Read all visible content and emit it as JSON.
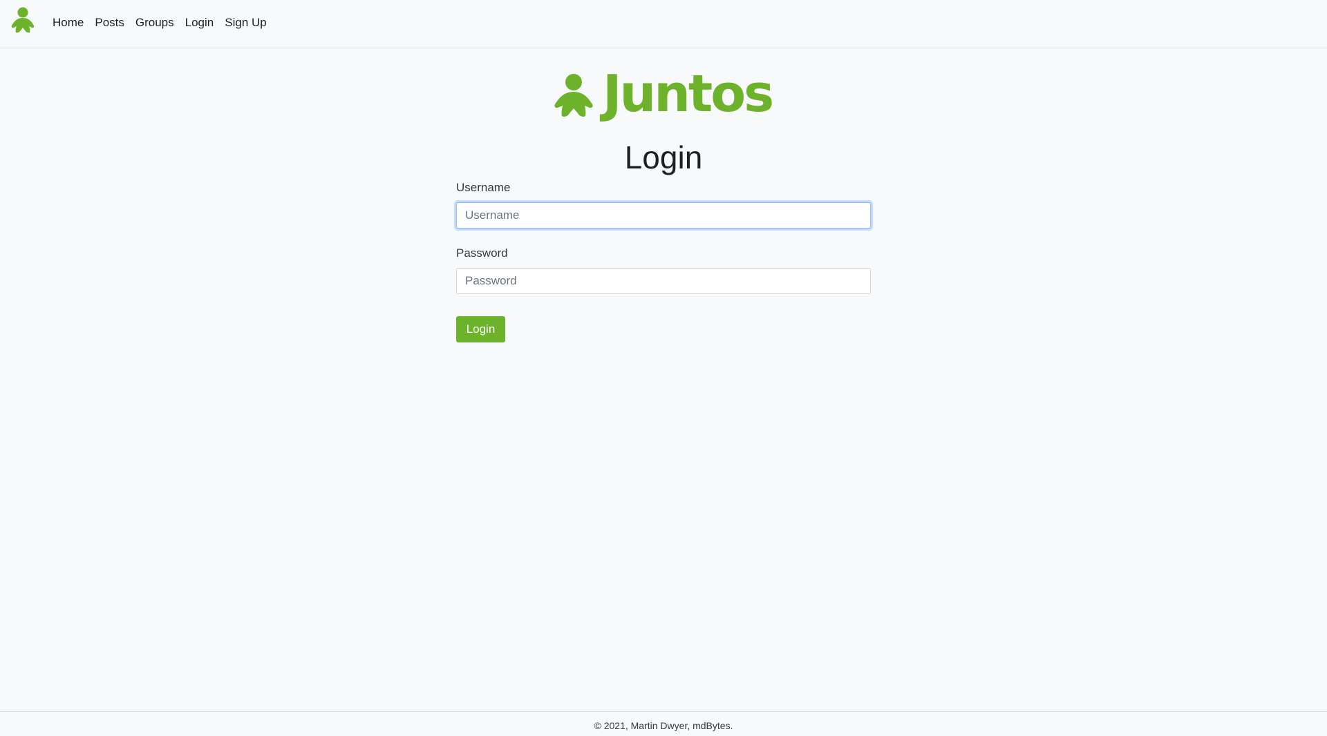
{
  "navbar": {
    "logo_icon": "juntos-person-icon",
    "links": [
      {
        "label": "Home"
      },
      {
        "label": "Posts"
      },
      {
        "label": "Groups"
      },
      {
        "label": "Login"
      },
      {
        "label": "Sign Up"
      }
    ]
  },
  "brand": {
    "name": "Juntos",
    "icon": "juntos-person-icon",
    "color": "#6cb22a"
  },
  "page": {
    "title": "Login"
  },
  "form": {
    "username_label": "Username",
    "username_placeholder": "Username",
    "username_value": "",
    "password_label": "Password",
    "password_placeholder": "Password",
    "password_value": "",
    "submit_label": "Login"
  },
  "footer": {
    "text": "© 2021, Martin Dwyer, mdBytes."
  }
}
